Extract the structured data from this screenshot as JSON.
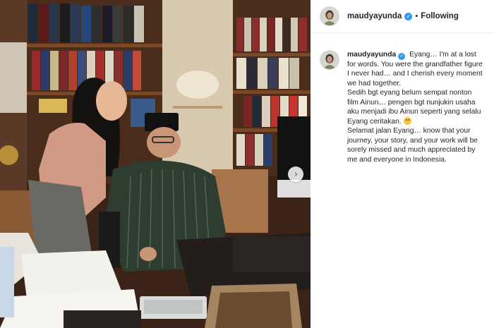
{
  "post": {
    "username": "maudyayunda",
    "verified": true,
    "separator": "•",
    "follow_status": "Following",
    "caption_paragraphs": [
      "Eyang… I'm at a lost for words. You were the grandfather figure I never had… and I cherish every moment we had together.",
      "Sedih bgt eyang belum sempat nonton film Ainun… pengen bgt nunjukin usaha aku menjadi ibu Ainun seperti yang selalu Eyang ceritakan.",
      "Selamat jalan Eyang… know that your journey, your story, and your work will be sorely missed and much appreciated by me and everyone in Indonesia."
    ]
  },
  "icons": {
    "verified": "verified-badge-icon",
    "carousel_next": "chevron-right-icon",
    "emoji": "sad-face-emoji-icon"
  },
  "colors": {
    "verified_blue": "#3897f0",
    "text": "#262626",
    "divider": "#efefef"
  },
  "ui": {
    "carousel_next_glyph": "›",
    "verified_glyph": "✓"
  }
}
